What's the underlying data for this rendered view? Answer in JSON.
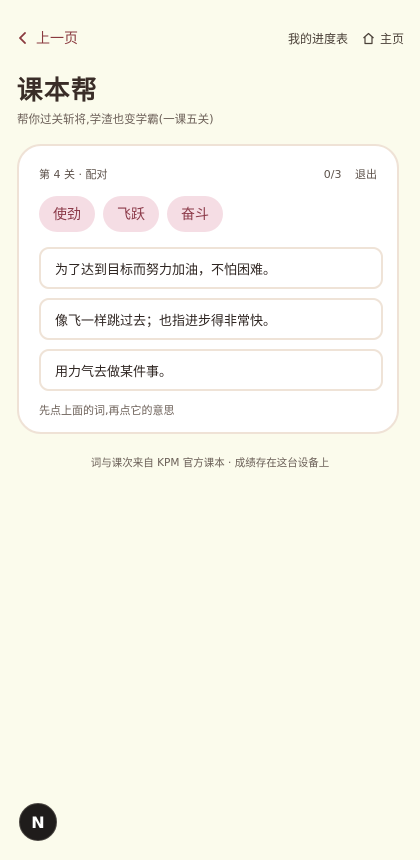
{
  "nav": {
    "back_label": "上一页",
    "progress_label": "我的进度表",
    "home_label": "主页"
  },
  "header": {
    "title": "课本帮",
    "subtitle": "帮你过关斩将,学渣也变学霸(一课五关)"
  },
  "quiz": {
    "level_label": "第 4 关 · 配对",
    "score": "0/3",
    "exit_label": "退出",
    "words": [
      "使劲",
      "飞跃",
      "奋斗"
    ],
    "meanings": [
      "为了达到目标而努力加油，不怕困难。",
      "像飞一样跳过去；也指进步得非常快。",
      "用力气去做某件事。"
    ],
    "hint": "先点上面的词,再点它的意思"
  },
  "footer": {
    "text": "词与课次来自 KPM 官方课本 · 成绩存在这台设备上"
  },
  "fab": {
    "label": "N"
  },
  "colors": {
    "background": "#fbfbec",
    "accent": "#8a3a3f",
    "chip_bg": "#f5dde4",
    "card_border": "#efe2d6"
  }
}
